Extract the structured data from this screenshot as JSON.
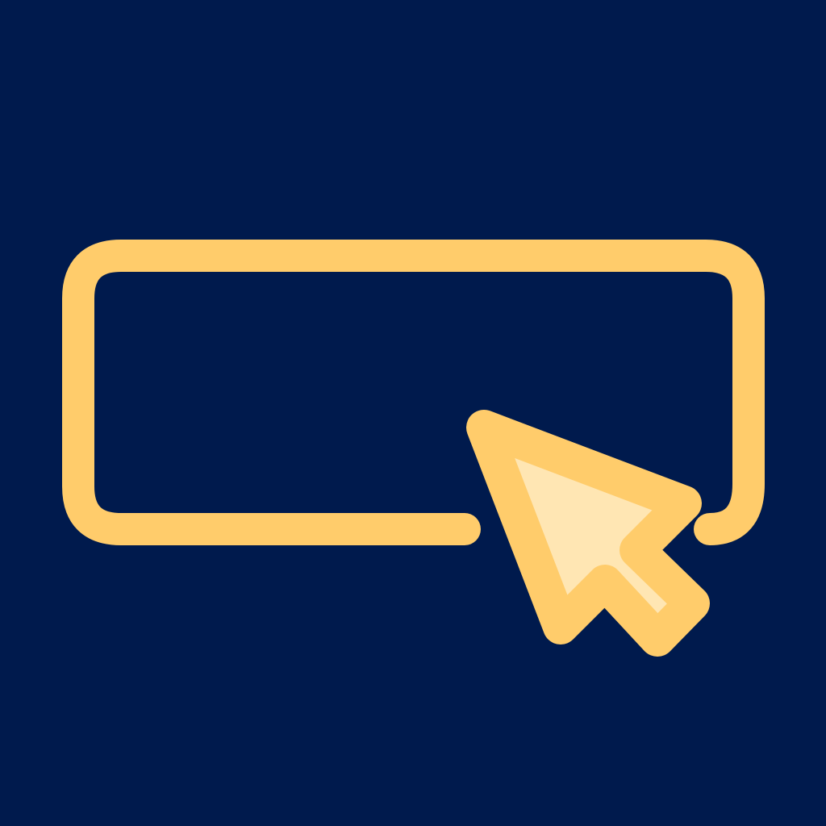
{
  "icon": {
    "name": "button-click-icon",
    "parts": [
      "button-outline-icon",
      "cursor-arrow-icon"
    ]
  },
  "colors": {
    "background": "#001a4d",
    "stroke": "#ffcc6b",
    "cursor_fill": "#ffe6b3"
  }
}
